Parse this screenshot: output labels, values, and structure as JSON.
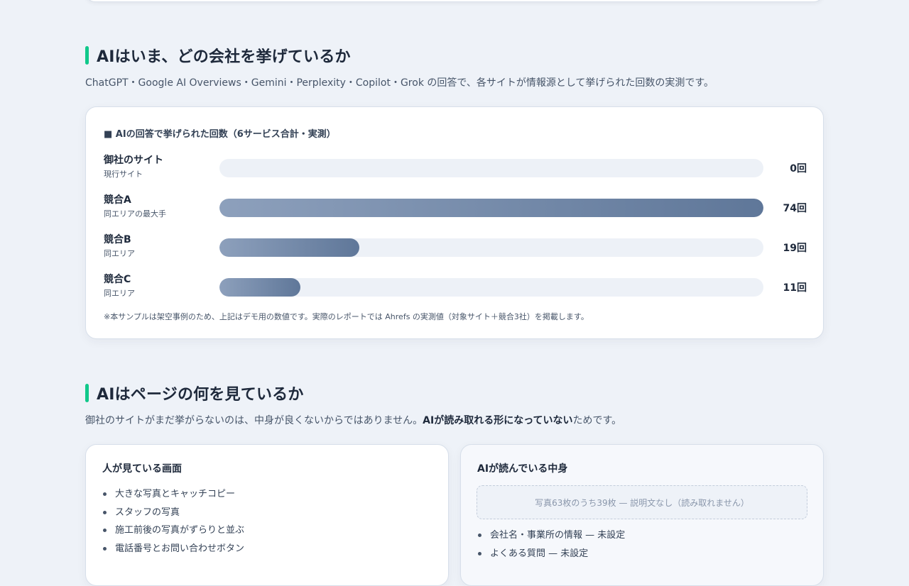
{
  "citation_section": {
    "title": "AIはいま、どの会社を挙げているか",
    "lead": "ChatGPT・Google AI Overviews・Gemini・Perplexity・Copilot・Grok の回答で、各サイトが情報源として挙げられた回数の実測です。",
    "chart_heading": "■ AIの回答で挙げられた回数（6サービス合計・実測）",
    "note": "※本サンプルは架空事例のため、上記はデモ用の数値です。実際のレポートでは Ahrefs の実測値（対象サイト＋競合3社）を掲載します。"
  },
  "chart_data": {
    "type": "bar",
    "title": "■ AIの回答で挙げられた回数（6サービス合計・実測）",
    "categories": [
      "御社のサイト",
      "競合A",
      "競合B",
      "競合C"
    ],
    "subtitles": [
      "現行サイト",
      "同エリアの最大手",
      "同エリア",
      "同エリア"
    ],
    "values": [
      0,
      74,
      19,
      11
    ],
    "value_labels": [
      "0回",
      "74回",
      "19回",
      "11回"
    ],
    "xlim": [
      0,
      74
    ],
    "bar_color_start": "#8da0bc",
    "bar_color_end": "#5f7799",
    "track_color": "#edf1f7"
  },
  "view_section": {
    "title": "AIはページの何を見ているか",
    "lead_prefix": "御社のサイトがまだ挙がらないのは、中身が良くないからではありません。",
    "lead_bold": "AIが読み取れる形になっていない",
    "lead_suffix": "ためです。"
  },
  "human_card": {
    "title": "人が見ている画面",
    "items": [
      "大きな写真とキャッチコピー",
      "スタッフの写真",
      "施工前後の写真がずらりと並ぶ",
      "電話番号とお問い合わせボタン"
    ]
  },
  "ai_card": {
    "title": "AIが読んでいる中身",
    "missing_note": "写真63枚のうち39枚 — 説明文なし（読み取れません）",
    "items": [
      "会社名・事業所の情報 — 未設定",
      "よくある質問 — 未設定"
    ]
  },
  "colors": {
    "accent": "#10c88a",
    "background": "#eef2f8",
    "text": "#1e293b"
  }
}
